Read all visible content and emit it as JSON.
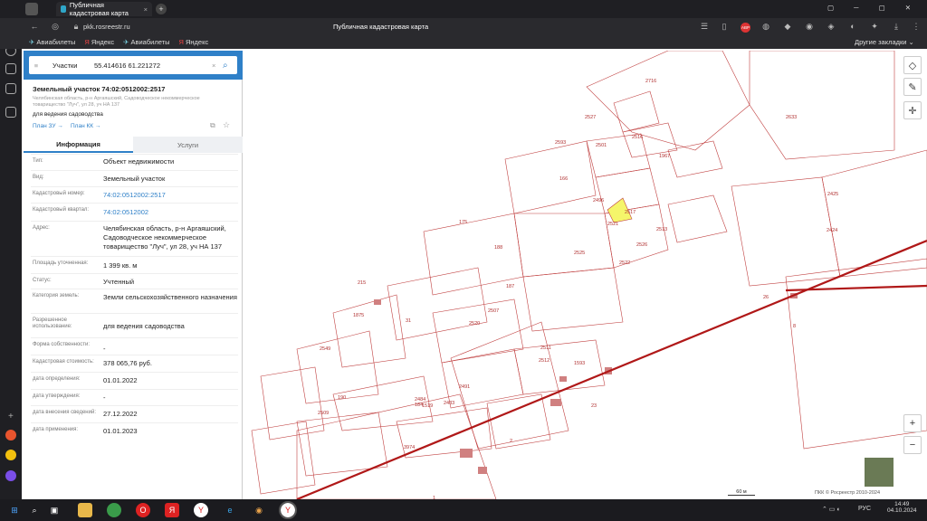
{
  "browser": {
    "tab_title": "Публичная кадастровая карта",
    "tab_close": "×",
    "new_tab": "+",
    "address": "pkk.rosreestr.ru",
    "page_title": "Публичная кадастровая карта",
    "bookmarks": [
      "Авиабилеты",
      "Яндекс",
      "Авиабилеты",
      "Яндекс"
    ],
    "other_bookmarks": "Другие закладки",
    "badge": "ABP"
  },
  "search": {
    "mode": "Участки",
    "query": "55.414616 61.221272",
    "clear": "×"
  },
  "parcel": {
    "title": "Земельный участок 74:02:0512002:2517",
    "subtitle": "Челябинская область, р-н Аргаяшский, Садоводческое некоммерческое товарищество \"Луч\", ул 28, уч НА 137",
    "use": "для ведения садоводства",
    "plan_zu": "План ЗУ →",
    "plan_kk": "План КК →"
  },
  "tabs": [
    "Информация",
    "Услуги"
  ],
  "info": [
    {
      "k": "Тип:",
      "v": "Объект недвижимости",
      "link": false
    },
    {
      "k": "Вид:",
      "v": "Земельный участок",
      "link": false
    },
    {
      "k": "Кадастровый номер:",
      "v": "74:02:0512002:2517",
      "link": true
    },
    {
      "k": "Кадастровый квартал:",
      "v": "74:02:0512002",
      "link": true
    },
    {
      "k": "Адрес:",
      "v": "Челябинская область, р-н Аргаяшский, Садоводческое некоммерческое товарищество \"Луч\", ул 28, уч НА 137",
      "link": false
    },
    {
      "k": "Площадь уточненная:",
      "v": "1 399 кв. м",
      "link": false
    },
    {
      "k": "Статус:",
      "v": "Учтенный",
      "link": false
    },
    {
      "k": "Категория земель:",
      "v": "Земли сельскохозяйственного назначения",
      "link": false
    },
    {
      "k": "Разрешенное использование:",
      "v": "для ведения садоводства",
      "link": false
    },
    {
      "k": "Форма собственности:",
      "v": "-",
      "link": false
    },
    {
      "k": "Кадастровая стоимость:",
      "v": "378 065,76 руб.",
      "link": false
    },
    {
      "k": "дата определения:",
      "v": "01.01.2022",
      "link": false
    },
    {
      "k": "дата утверждения:",
      "v": "-",
      "link": false
    },
    {
      "k": "дата внесения сведений:",
      "v": "27.12.2022",
      "link": false
    },
    {
      "k": "дата применения:",
      "v": "01.01.2023",
      "link": false
    }
  ],
  "map": {
    "scale_label": "60 м",
    "copyright": "ПКК © Росреестр 2010-2024",
    "zoom_in": "+",
    "zoom_out": "−",
    "labels": [
      "2716",
      "2527",
      "2633",
      "2516",
      "2593",
      "2501",
      "1967",
      "2496",
      "2517",
      "2513",
      "2521",
      "2526",
      "2525",
      "2522",
      "2425",
      "2424",
      "8",
      "26",
      "1593",
      "23",
      "2",
      "3974",
      "1",
      "2509",
      "190",
      "184",
      "2483",
      "2511",
      "2512",
      "2491",
      "2507",
      "2520",
      "2549",
      "2484",
      "1875",
      "31",
      "215",
      "175",
      "188",
      "187",
      "166",
      "1519"
    ],
    "selected_parcel": "2517",
    "selected_color": "#f5f56a",
    "line_color": "#b01818"
  },
  "taskbar": {
    "lang": "РУС",
    "time": "14:49",
    "date": "04.10.2024"
  }
}
